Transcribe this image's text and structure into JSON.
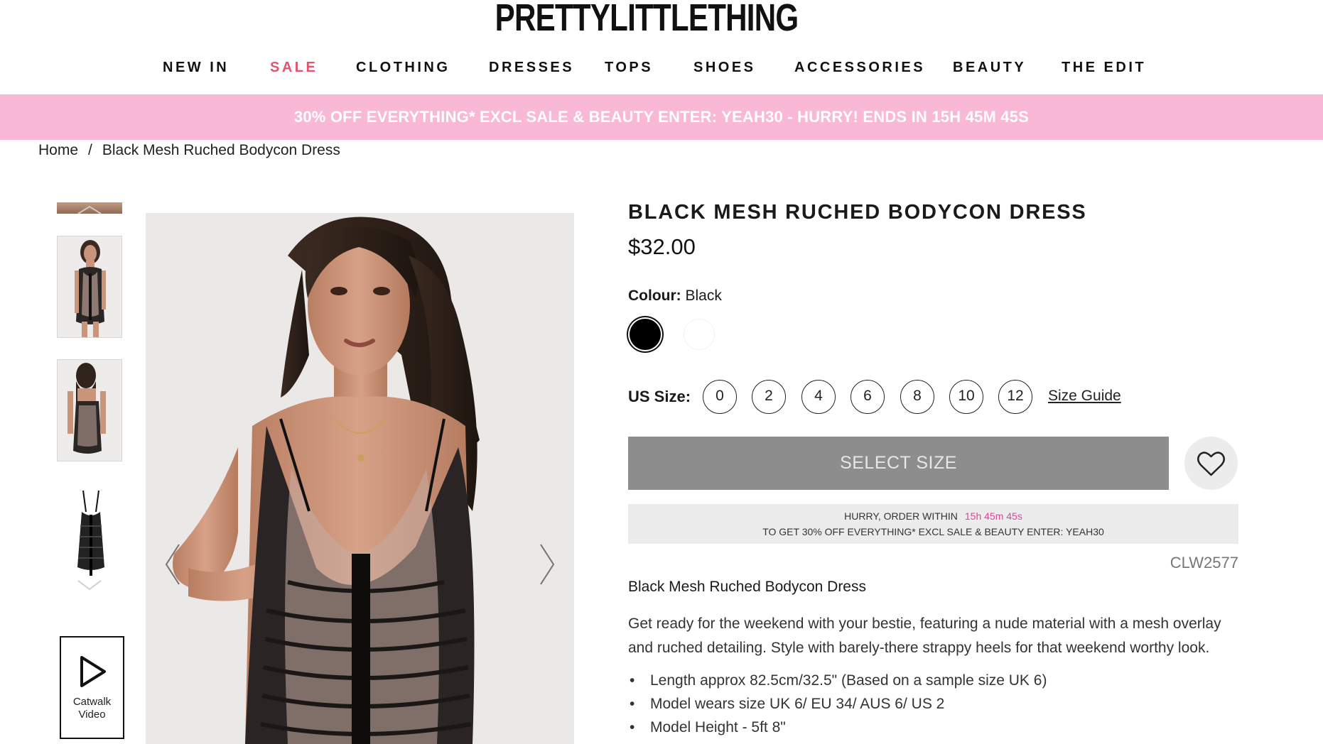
{
  "brand": "PRETTYLITTLETHING",
  "nav": [
    {
      "label": "NEW IN"
    },
    {
      "label": "SALE"
    },
    {
      "label": "CLOTHING"
    },
    {
      "label": "DRESSES"
    },
    {
      "label": "TOPS"
    },
    {
      "label": "SHOES"
    },
    {
      "label": "ACCESSORIES"
    },
    {
      "label": "BEAUTY"
    },
    {
      "label": "THE EDIT"
    }
  ],
  "promo": "30% OFF EVERYTHING* EXCL SALE & BEAUTY ENTER: YEAH30 - HURRY! ENDS IN 15H 45M 45S",
  "breadcrumb": {
    "home": "Home",
    "separator": "/",
    "current": "Black Mesh Ruched Bodycon Dress"
  },
  "catwalk": {
    "line1": "Catwalk",
    "line2": "Video"
  },
  "product": {
    "title": "BLACK MESH RUCHED BODYCON DRESS",
    "price": "$32.00",
    "colour_label": "Colour:",
    "colour_value": "Black",
    "swatches": [
      {
        "name": "Black",
        "hex": "#000000",
        "selected": true
      },
      {
        "name": "White",
        "hex": "#ffffff",
        "selected": false
      }
    ],
    "size_label": "US Size:",
    "sizes": [
      "0",
      "2",
      "4",
      "6",
      "8",
      "10",
      "12"
    ],
    "size_guide": "Size Guide",
    "add_button": "SELECT SIZE",
    "hurry_line1": "HURRY, ORDER WITHIN",
    "hurry_timer": "15h 45m 45s",
    "hurry_line2": "TO GET 30% OFF EVERYTHING* EXCL SALE & BEAUTY ENTER: YEAH30",
    "code": "CLW2577",
    "desc_title": "Black Mesh Ruched Bodycon Dress",
    "description": "Get ready for the weekend with your bestie, featuring a nude material with a mesh overlay and ruched detailing. Style with barely-there strappy heels for that weekend worthy look.",
    "bullets": [
      "Length approx 82.5cm/32.5\" (Based on a sample size UK 6)",
      "Model wears size UK 6/ EU 34/ AUS 6/ US 2",
      "Model Height - 5ft 8\""
    ]
  },
  "colors": {
    "promo_bg": "#f8b8d6",
    "sale": "#e0546d",
    "timer": "#e0449a",
    "button_bg": "#8d8d8d"
  }
}
